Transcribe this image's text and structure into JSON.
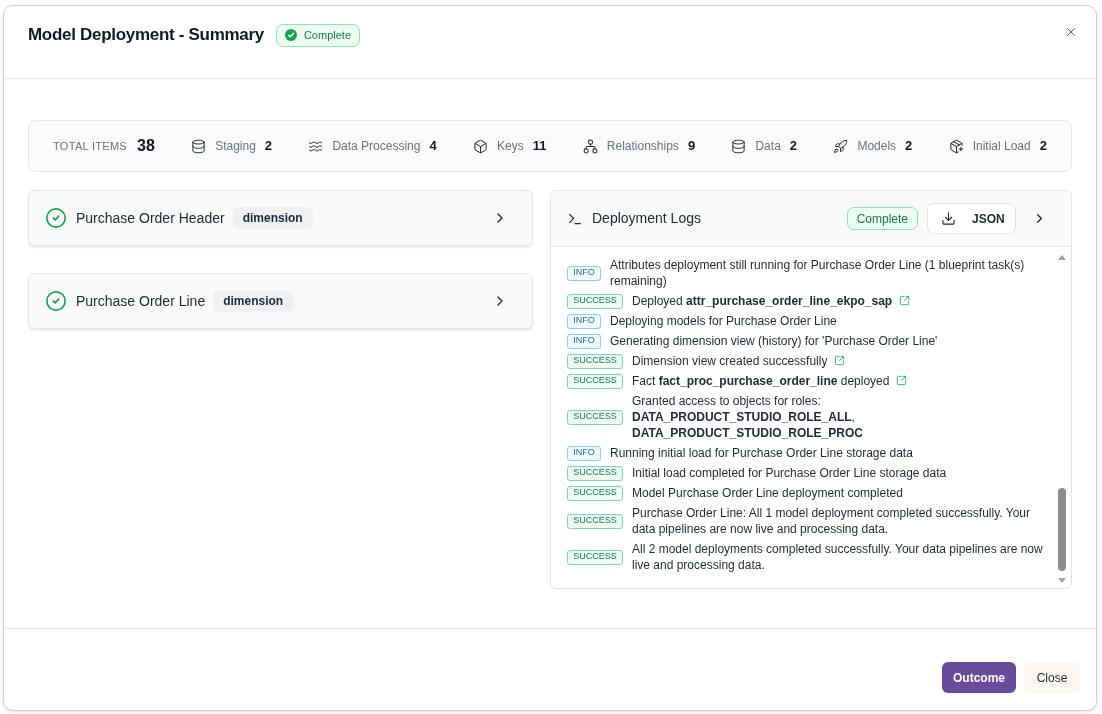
{
  "dialog": {
    "title": "Model Deployment - Summary",
    "status": "Complete"
  },
  "summary": {
    "total_label": "TOTAL ITEMS",
    "total_value": "38",
    "stats": [
      {
        "kind": "staging",
        "label": "Staging",
        "value": "2"
      },
      {
        "kind": "processing",
        "label": "Data Processing",
        "value": "4"
      },
      {
        "kind": "keys",
        "label": "Keys",
        "value": "11"
      },
      {
        "kind": "relationships",
        "label": "Relationships",
        "value": "9"
      },
      {
        "kind": "data",
        "label": "Data",
        "value": "2"
      },
      {
        "kind": "models",
        "label": "Models",
        "value": "2"
      },
      {
        "kind": "load",
        "label": "Initial Load",
        "value": "2"
      }
    ]
  },
  "models": [
    {
      "name": "Purchase Order Header",
      "type": "dimension",
      "complete": true
    },
    {
      "name": "Purchase Order Line",
      "type": "dimension",
      "complete": true
    }
  ],
  "logs": {
    "title": "Deployment Logs",
    "status": "Complete",
    "download_label": "JSON",
    "entries": [
      {
        "kind": "info",
        "badge": "INFO",
        "text": "Attributes deployment still running for Purchase Order Line (1 blueprint task(s) remaining)",
        "link": false
      },
      {
        "kind": "success",
        "badge": "SUCCESS",
        "text": "Deployed **attr_purchase_order_line_ekpo_sap**",
        "link": true
      },
      {
        "kind": "info",
        "badge": "INFO",
        "text": "Deploying models for Purchase Order Line",
        "link": false
      },
      {
        "kind": "info",
        "badge": "INFO",
        "text": "Generating dimension view (history) for 'Purchase Order Line'",
        "link": false
      },
      {
        "kind": "success",
        "badge": "SUCCESS",
        "text": "Dimension view created successfully",
        "link": true
      },
      {
        "kind": "success",
        "badge": "SUCCESS",
        "text": "Fact **fact_proc_purchase_order_line** deployed",
        "link": true
      },
      {
        "kind": "success",
        "badge": "SUCCESS",
        "text": "Granted access to objects for roles: **DATA_PRODUCT_STUDIO_ROLE_ALL**, **DATA_PRODUCT_STUDIO_ROLE_PROC**",
        "link": false
      },
      {
        "kind": "info",
        "badge": "INFO",
        "text": "Running initial load for Purchase Order Line storage data",
        "link": false
      },
      {
        "kind": "success",
        "badge": "SUCCESS",
        "text": "Initial load completed for Purchase Order Line storage data",
        "link": false
      },
      {
        "kind": "success",
        "badge": "SUCCESS",
        "text": "Model Purchase Order Line deployment completed",
        "link": false
      },
      {
        "kind": "success",
        "badge": "SUCCESS",
        "text": "Purchase Order Line: All 1 model deployment completed successfully. Your data pipelines are now live and processing data.",
        "link": false
      },
      {
        "kind": "success",
        "badge": "SUCCESS",
        "text": "All 2 model deployments completed successfully. Your data pipelines are now live and processing data.",
        "link": false
      }
    ]
  },
  "footer": {
    "buttons": [
      {
        "kind": "primary",
        "label": "Outcome"
      },
      {
        "kind": "secondary",
        "label": "Close"
      }
    ]
  }
}
